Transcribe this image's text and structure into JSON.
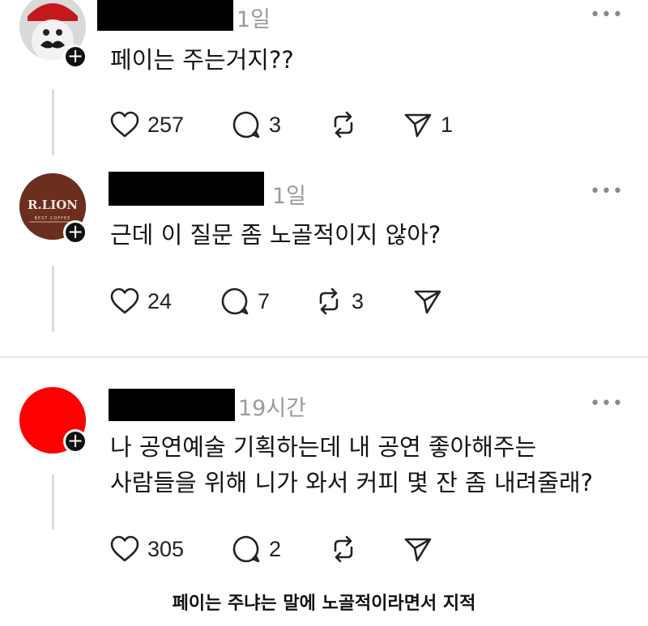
{
  "comments": [
    {
      "time": "1일",
      "text_lines": [
        "페이는 주는거지??"
      ],
      "avatar": "mascot-avatar",
      "likes": "257",
      "replies": "3",
      "reposts": "",
      "shares": "1"
    },
    {
      "time": "1일",
      "text_lines": [
        "근데 이 질문 좀 노골적이지 않아?"
      ],
      "avatar": "cafe-logo-avatar",
      "logo_main": "R.LION",
      "logo_sub": "BEST COFFEE",
      "likes": "24",
      "replies": "7",
      "reposts": "3",
      "shares": ""
    },
    {
      "time": "19시간",
      "text_lines": [
        "나 공연예술 기획하는데 내 공연 좋아해주는",
        "사람들을 위해 니가 와서 커피 몇 잔 좀 내려줄래?"
      ],
      "avatar": "red-circle-avatar",
      "likes": "305",
      "replies": "2",
      "reposts": "",
      "shares": ""
    }
  ],
  "more_label": "•••",
  "follow_label": "+",
  "caption": "페이는 주냐는 말에 노골적이라면서 지적",
  "colors": {
    "logo_bg": "#6b2e1f",
    "red_avatar": "#ff0000",
    "redaction": "#000000",
    "muted": "#9a9a9a"
  }
}
